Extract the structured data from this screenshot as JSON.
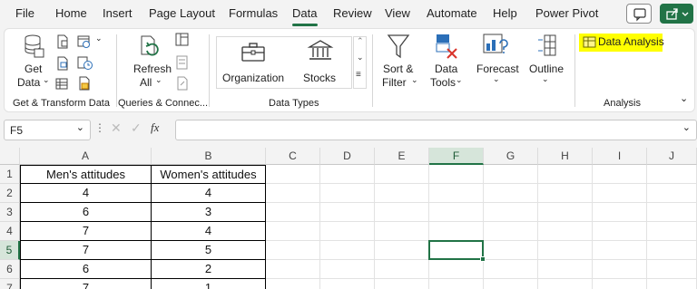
{
  "menu": {
    "tabs": [
      "File",
      "Home",
      "Insert",
      "Page Layout",
      "Formulas",
      "Data",
      "Review",
      "View",
      "Automate",
      "Help",
      "Power Pivot"
    ],
    "active_tab": "Data"
  },
  "ribbon": {
    "get_data": [
      "Get",
      "Data"
    ],
    "refresh_all": [
      "Refresh",
      "All"
    ],
    "organization": "Organization",
    "stocks": "Stocks",
    "sort_filter": [
      "Sort &",
      "Filter"
    ],
    "data_tools": [
      "Data",
      "Tools"
    ],
    "forecast": "Forecast",
    "outline": "Outline",
    "data_analysis": "Data Analysis",
    "groups": {
      "get_transform": "Get & Transform Data",
      "queries": "Queries & Connec...",
      "data_types": "Data Types",
      "analysis": "Analysis"
    },
    "highlight_color": "#ffff00",
    "accent_color": "#217346"
  },
  "formula_bar": {
    "name_box": "F5",
    "fx": "fx",
    "formula": ""
  },
  "grid": {
    "columns": [
      "A",
      "B",
      "C",
      "D",
      "E",
      "F",
      "G",
      "H",
      "I",
      "J"
    ],
    "rows": [
      "1",
      "2",
      "3",
      "4",
      "5",
      "6",
      "7"
    ],
    "selected_cell": "F5",
    "headers": [
      "Men's attitudes",
      "Women's attitudes"
    ],
    "data": [
      [
        "4",
        "4"
      ],
      [
        "6",
        "3"
      ],
      [
        "7",
        "4"
      ],
      [
        "7",
        "5"
      ],
      [
        "6",
        "2"
      ],
      [
        "7",
        "1"
      ]
    ]
  }
}
